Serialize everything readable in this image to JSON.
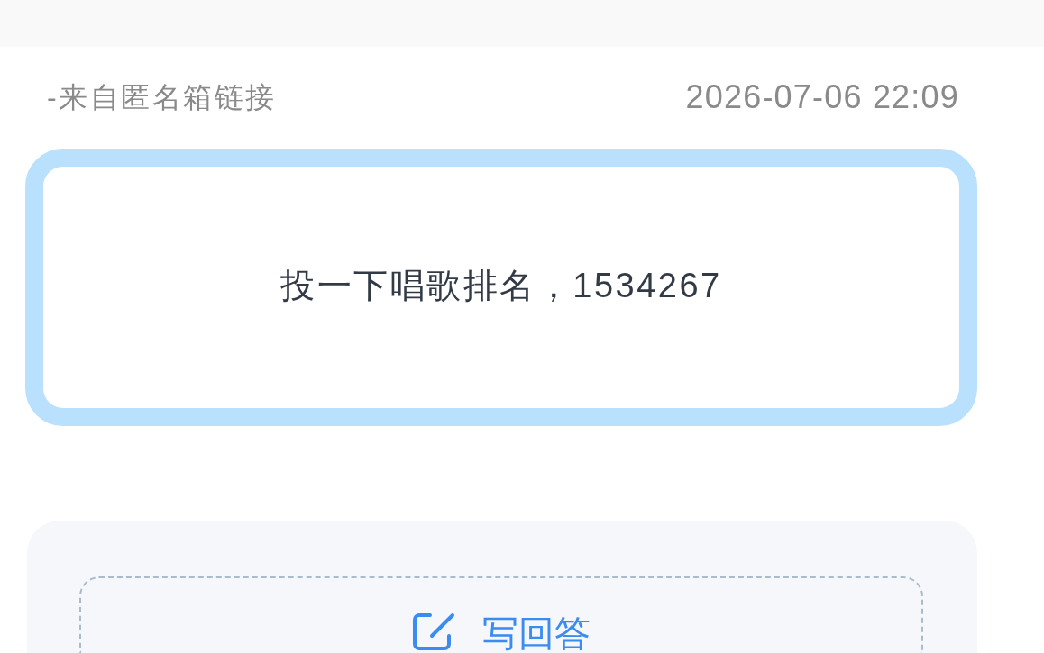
{
  "source": "-来自匿名箱链接",
  "time": "2026-07-06 22:09",
  "question": {
    "text": "投一下唱歌排名，1534267"
  },
  "answer_button": {
    "label": "写回答"
  }
}
